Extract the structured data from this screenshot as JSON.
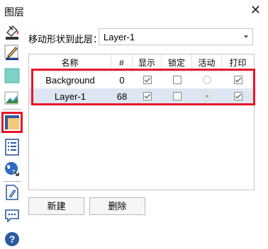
{
  "window": {
    "title": "图层",
    "close_glyph": "✕"
  },
  "toolbar": {
    "icons": [
      "paint-bucket-icon",
      "pen-icon",
      "fill-color-icon",
      "shape-edit-icon",
      "layers-icon",
      "list-icon",
      "globe-icon",
      "attach-icon",
      "comment-icon",
      "help-icon"
    ],
    "selected": "layers-icon"
  },
  "move_shape": {
    "label": "移动形状到此层：",
    "selected_value": "Layer-1"
  },
  "table": {
    "headers": [
      "名称",
      "#",
      "显示",
      "锁定",
      "活动",
      "打印"
    ],
    "rows": [
      {
        "name": "Background",
        "count": "0",
        "visible": true,
        "locked": false,
        "active": false,
        "print": true,
        "selected": false
      },
      {
        "name": "Layer-1",
        "count": "68",
        "visible": true,
        "locked": false,
        "active": true,
        "print": true,
        "selected": true
      }
    ]
  },
  "buttons": {
    "new_label": "新建",
    "delete_label": "删除"
  },
  "colors": {
    "highlight": "#e8152a",
    "selected_row": "#dde6f2"
  }
}
